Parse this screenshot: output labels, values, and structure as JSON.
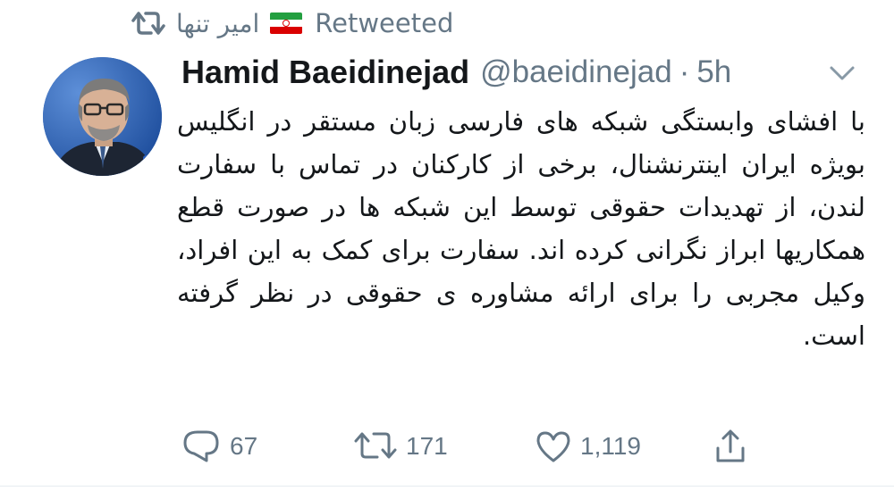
{
  "retweet_bar": {
    "user": "امیر تنها",
    "label": "Retweeted"
  },
  "tweet": {
    "display_name": "Hamid Baeidinejad",
    "handle": "@baeidinejad",
    "separator": "·",
    "time": "5h",
    "text": "با افشای وابستگی شبکه های فارسی زبان مستقر در انگلیس بویژه ایران اینترنشنال، برخی از کارکنان در تماس با سفارت لندن، از تهدیدات حقوقی توسط این شبکه ها در صورت قطع همکاریها ابراز نگرانی کرده اند. سفارت برای کمک به این افراد، وکیل مجربی را برای ارائه مشاوره ی حقوقی در نظر گرفته است."
  },
  "actions": {
    "replies": "67",
    "retweets": "171",
    "likes": "1,119"
  },
  "icons": {
    "retweet": "retweet-icon",
    "flag": "iran-flag-icon",
    "caret": "chevron-down-icon",
    "reply": "reply-icon",
    "like": "heart-icon",
    "share": "share-icon"
  },
  "colors": {
    "secondary_text": "#657786",
    "primary_text": "#14171a"
  }
}
